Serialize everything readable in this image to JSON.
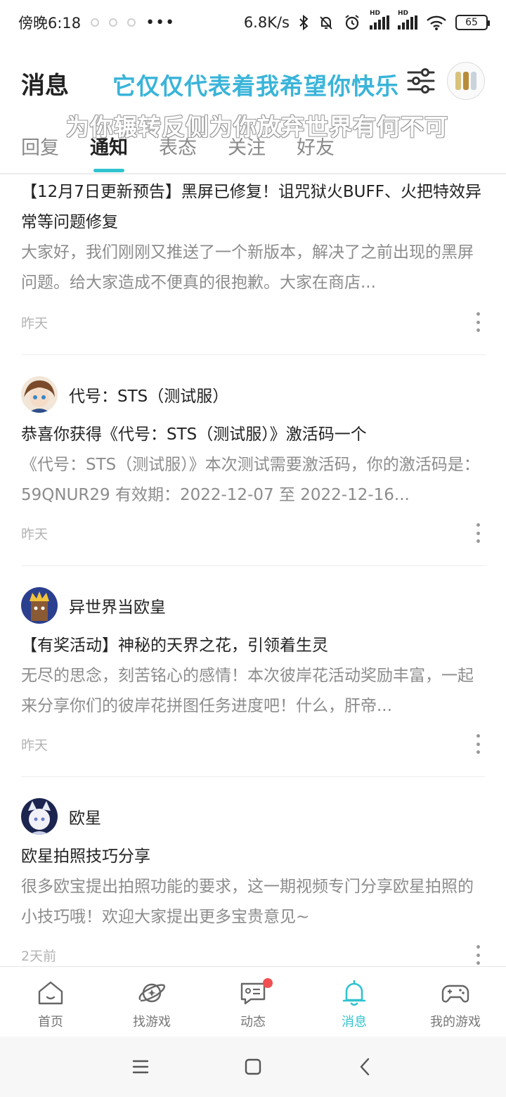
{
  "status_bar": {
    "time": "傍晚6:18",
    "more": "•••",
    "network_speed": "6.8K/s",
    "signal_tag_1": "HD",
    "signal_tag_2": "HD",
    "battery": "65"
  },
  "header": {
    "title": "消息",
    "overlay_line_1": "它仅仅代表着我希望你快乐",
    "overlay_line_2": "为你辗转反侧为你放弃世界有何不可"
  },
  "tabs": [
    {
      "label": "回复",
      "active": false
    },
    {
      "label": "通知",
      "active": true
    },
    {
      "label": "表态",
      "active": false
    },
    {
      "label": "关注",
      "active": false
    },
    {
      "label": "好友",
      "active": false
    }
  ],
  "notifications": [
    {
      "author": "",
      "title": "【12月7日更新预告】黑屏已修复！诅咒狱火BUFF、火把特效异常等问题修复",
      "body": "大家好，我们刚刚又推送了一个新版本，解决了之前出现的黑屏问题。给大家造成不便真的很抱歉。大家在商店...",
      "time": "昨天"
    },
    {
      "author": "代号：STS（测试服）",
      "title": "恭喜你获得《代号：STS（测试服）》激活码一个",
      "body": "《代号：STS（测试服）》本次测试需要激活码，你的激活码是：59QNUR29 有效期：2022-12-07 至 2022-12-16...",
      "time": "昨天"
    },
    {
      "author": "异世界当欧皇",
      "title": "【有奖活动】神秘的天界之花，引领着生灵",
      "body": "无尽的思念，刻苦铭心的感情！本次彼岸花活动奖励丰富，一起来分享你们的彼岸花拼图任务进度吧！什么，肝帝...",
      "time": "昨天"
    },
    {
      "author": "欧星",
      "title": "欧星拍照技巧分享",
      "body": "很多欧宝提出拍照功能的要求，这一期视频专门分享欧星拍照的小技巧哦！欢迎大家提出更多宝贵意见~",
      "time": "2天前"
    }
  ],
  "bottom_nav": [
    {
      "label": "首页",
      "icon": "home-icon",
      "active": false
    },
    {
      "label": "找游戏",
      "icon": "planet-icon",
      "active": false
    },
    {
      "label": "动态",
      "icon": "chat-icon",
      "active": false
    },
    {
      "label": "消息",
      "icon": "bell-icon",
      "active": true
    },
    {
      "label": "我的游戏",
      "icon": "gamepad-icon",
      "active": false
    }
  ],
  "colors": {
    "accent": "#2fc3cf",
    "overlay_blue": "#3ab4d9",
    "badge_red": "#f05050"
  }
}
